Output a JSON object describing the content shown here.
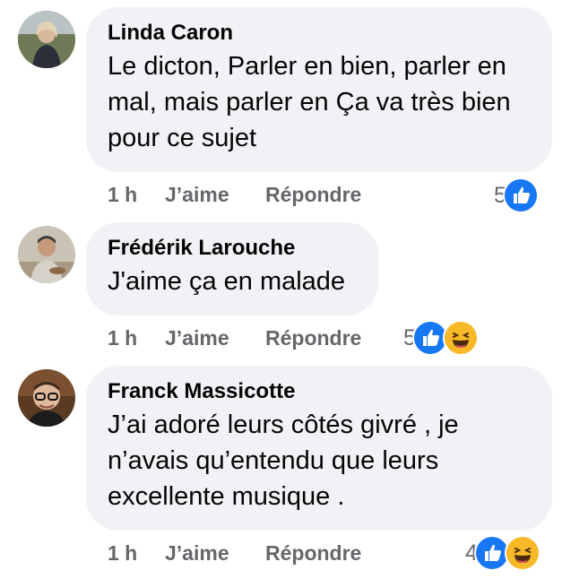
{
  "comments": [
    {
      "author": "Linda Caron",
      "text": "Le dicton, Parler en bien, parler en mal, mais parler en Ça va très bien pour ce sujet",
      "time": "1 h",
      "like_label": "J’aime",
      "reply_label": "Répondre",
      "reaction_count": "5",
      "reactions": [
        "like-icon"
      ]
    },
    {
      "author": "Frédérik Larouche",
      "text": "J'aime ça en malade",
      "time": "1 h",
      "like_label": "J’aime",
      "reply_label": "Répondre",
      "reaction_count": "5",
      "reactions": [
        "like-icon",
        "haha-icon"
      ]
    },
    {
      "author": "Franck Massicotte",
      "text": "J’ai adoré leurs côtés givré , je n’avais qu’entendu que leurs excellente musique .",
      "time": "1 h",
      "like_label": "J’aime",
      "reply_label": "Répondre",
      "reaction_count": "4",
      "reactions": [
        "like-icon",
        "haha-icon"
      ]
    }
  ],
  "colors": {
    "bubble": "#f0f2f5",
    "meta_text": "#65676b",
    "like_blue": "#1877f2",
    "haha_yellow": "#f7b928"
  }
}
